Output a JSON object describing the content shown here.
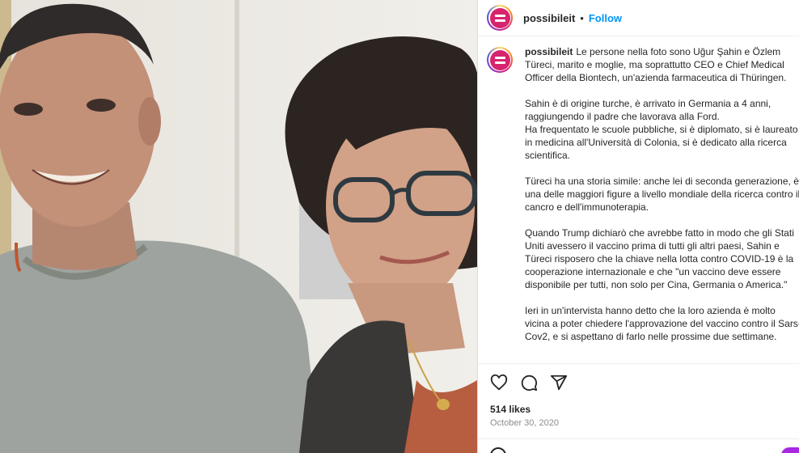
{
  "post": {
    "username": "possibileit",
    "follow_label": "Follow",
    "separator": "•",
    "likes": "514 likes",
    "date": "October 30, 2020"
  },
  "caption": {
    "username": "possibileit",
    "paragraphs": [
      [
        "Le persone nella foto sono Uğur Şahin e Özlem",
        "Türeci, marito e moglie, ma soprattutto CEO e Chief Medical",
        "Officer della Biontech, un'azienda farmaceutica di Thüringen."
      ],
      [
        "Sahin è di origine turche, è arrivato in Germania a 4 anni,",
        "raggiungendo il padre che lavorava alla Ford.",
        "Ha frequentato le scuole pubbliche, si è diplomato, si è laureato",
        "in medicina all'Università di Colonia, si è dedicato alla ricerca",
        "scientifica."
      ],
      [
        "Türeci ha una storia simile: anche lei di seconda generazione, è",
        "una delle maggiori figure a livello mondiale della ricerca contro il",
        "cancro e dell'immunoterapia."
      ],
      [
        "Quando Trump dichiarò che avrebbe fatto in modo che gli Stati",
        "Uniti avessero il vaccino prima di tutti gli altri paesi, Sahin e",
        "Türeci risposero che la chiave nella lotta contro COVID-19 è la",
        "cooperazione internazionale e che \"un vaccino deve essere",
        "disponibile per tutti, non solo per Cina, Germania o America.\""
      ],
      [
        "Ieri in un'intervista hanno detto che la loro azienda è molto",
        "vicina a poter chiedere l'approvazione del vaccino contro il Sars-",
        "Cov2, e si aspettano di farlo nelle prossime due settimane."
      ]
    ]
  },
  "icons": {
    "like": "heart-icon",
    "comment": "comment-icon",
    "share": "share-icon"
  },
  "colors": {
    "follow": "#0095f6",
    "avatar": "#d6246e"
  }
}
